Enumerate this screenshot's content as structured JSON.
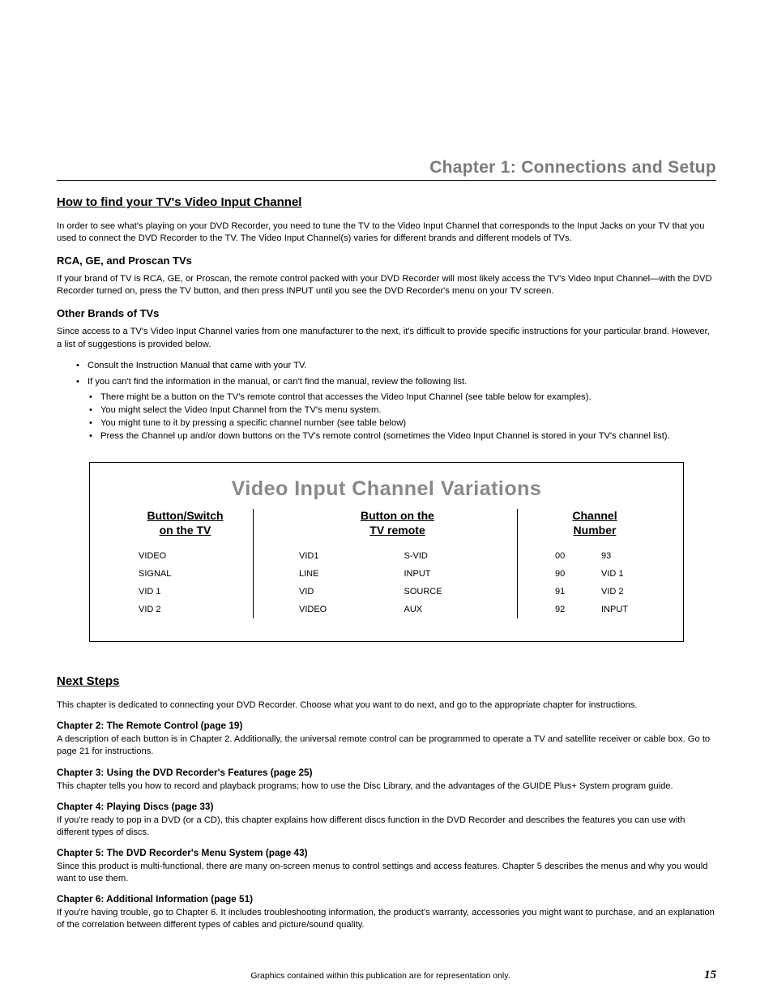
{
  "chapter_title": "Chapter 1: Connections and Setup",
  "s1": {
    "heading": "How to find your TV's Video Input Channel",
    "intro": "In order to see what's playing on your DVD Recorder, you need to tune the TV to the Video Input Channel that corresponds to the Input Jacks on your TV that you used to connect the DVD Recorder to the TV. The Video Input Channel(s) varies for different brands and different models of TVs.",
    "sub1_heading": "RCA, GE, and Proscan TVs",
    "sub1_para": "If your brand of TV is RCA, GE, or Proscan, the remote control packed with your DVD Recorder will most likely access the TV's Video Input Channel—with the DVD Recorder turned on, press the TV button, and then press INPUT until you see the DVD Recorder's menu on your TV screen.",
    "sub2_heading": "Other Brands of TVs",
    "sub2_para": "Since access to a TV's Video Input Channel varies from one manufacturer to the next, it's difficult to provide specific instructions for your particular brand. However, a list of suggestions is provided below.",
    "bullets": [
      "Consult the Instruction Manual that came with your TV.",
      "If you can't find the information in the manual, or can't find the manual, review the following list."
    ],
    "subbullets": [
      "There might be a button on the TV's remote control that accesses the Video Input Channel (see table below for examples).",
      "You might select the Video Input Channel from the TV's menu system.",
      "You might tune to it by pressing a specific channel number (see table below)",
      "Press the Channel up and/or down buttons on the TV's remote control (sometimes the Video Input Channel is stored in your TV's channel list)."
    ]
  },
  "chart_data": {
    "type": "table",
    "title": "Video Input Channel Variations",
    "columns": [
      {
        "header": "Button/Switch\non the TV",
        "rows": [
          "VIDEO",
          "SIGNAL",
          "VID 1",
          "VID 2"
        ]
      },
      {
        "header": "Button on the\nTV remote",
        "rows_a": [
          "VID1",
          "LINE",
          "VID",
          "VIDEO"
        ],
        "rows_b": [
          "S-VID",
          "INPUT",
          "SOURCE",
          "AUX"
        ]
      },
      {
        "header": "Channel\nNumber",
        "rows_a": [
          "00",
          "90",
          "91",
          "92"
        ],
        "rows_b": [
          "93",
          "VID 1",
          "VID 2",
          "INPUT"
        ]
      }
    ]
  },
  "s2": {
    "heading": "Next Steps",
    "intro": "This chapter is dedicated to connecting your DVD Recorder. Choose what you want to do next, and go to the appropriate chapter for instructions.",
    "chapters": [
      {
        "title": "Chapter 2: The Remote Control (page 19)",
        "desc": "A description of each button is in Chapter 2. Additionally, the universal remote control can be programmed to operate a TV and satellite receiver or cable box. Go to page 21 for instructions."
      },
      {
        "title": "Chapter 3: Using the DVD Recorder's Features (page 25)",
        "desc": "This chapter tells you how to record and playback programs; how to use the Disc Library,  and the advantages of the GUIDE Plus+ System program guide."
      },
      {
        "title": "Chapter 4: Playing Discs (page 33)",
        "desc": "If you're ready to pop in a DVD (or a CD), this chapter explains how different discs function in the DVD Recorder and describes the features you can use with different types of discs."
      },
      {
        "title": "Chapter 5: The DVD Recorder's Menu System (page 43)",
        "desc": "Since this product is multi-functional, there are many on-screen menus to control settings and access features. Chapter 5 describes the menus and why you would want to use them."
      },
      {
        "title": "Chapter 6: Additional Information (page 51)",
        "desc": "If you're having trouble, go to Chapter 6. It includes troubleshooting information, the product's warranty, accessories you might want to purchase, and an explanation of the correlation between different types of cables and picture/sound quality."
      }
    ]
  },
  "footer_text": "Graphics contained within this publication are for representation only.",
  "page_num": "15"
}
